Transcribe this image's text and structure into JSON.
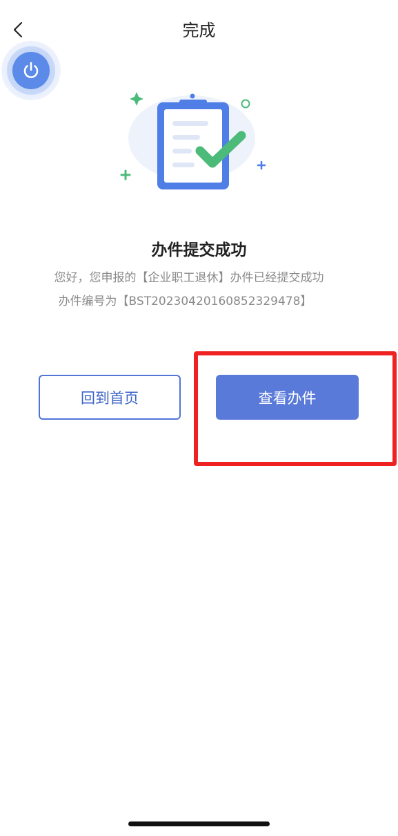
{
  "nav": {
    "title": "完成",
    "back_icon": "chevron-left-icon"
  },
  "floating_button": {
    "icon": "power-icon",
    "color": "#5b8ae8"
  },
  "illustration": {
    "icon": "clipboard-check-icon",
    "colors": {
      "clipboard": "#4f7ee6",
      "check": "#4cbb79",
      "plus_green": "#4cbb79",
      "plus_blue": "#4f7ee6"
    }
  },
  "result": {
    "title": "办件提交成功",
    "description": "您好，您申报的【企业职工退休】办件已经提交成功",
    "case_number_line": "办件编号为【BST20230420160852329478】"
  },
  "actions": {
    "home_label": "回到首页",
    "view_label": "查看办件",
    "primary_color": "#5a7ad9",
    "highlight_color": "#ee2222"
  }
}
